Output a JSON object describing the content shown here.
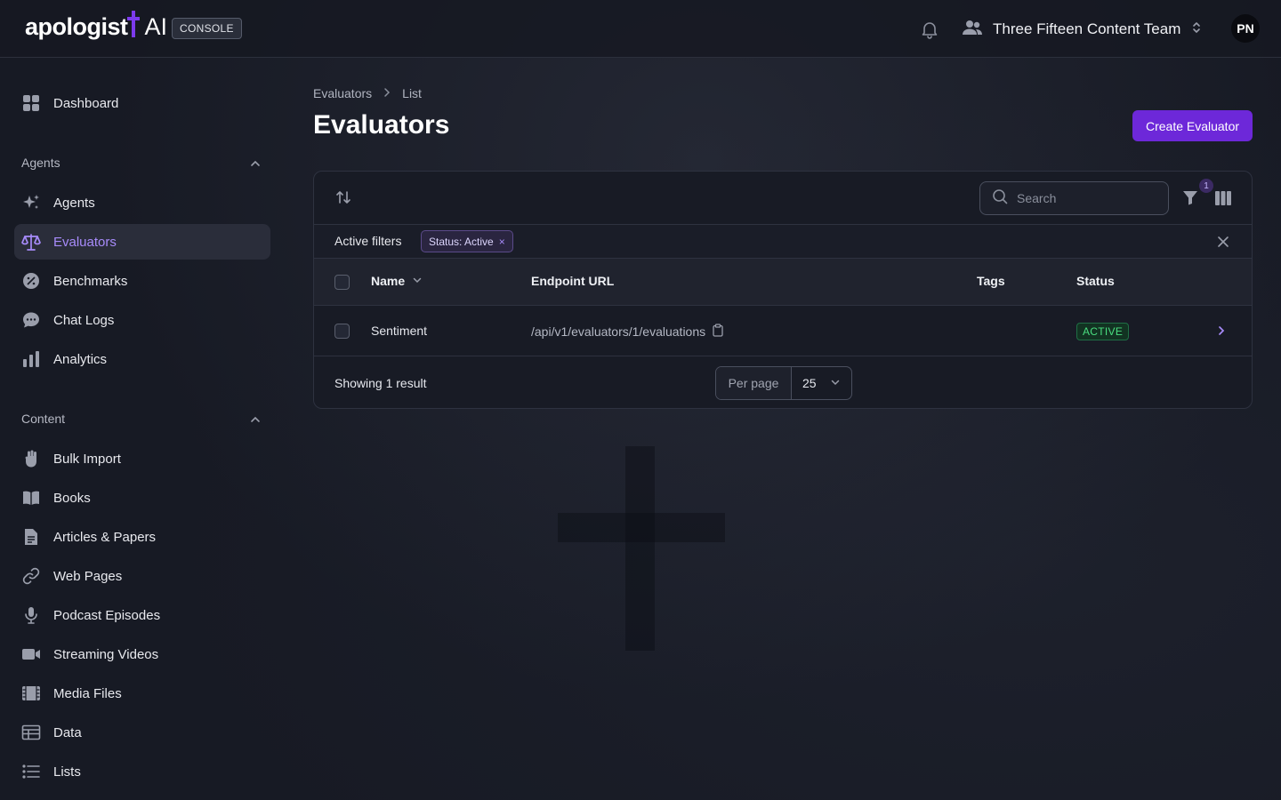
{
  "header": {
    "logo_text": "apologist",
    "logo_ai": "AI",
    "console_badge": "CONSOLE",
    "team_name": "Three Fifteen Content Team",
    "avatar_initials": "PN"
  },
  "sidebar": {
    "dashboard": "Dashboard",
    "groups": {
      "agents": "Agents",
      "content": "Content"
    },
    "agents_items": [
      "Agents",
      "Evaluators",
      "Benchmarks",
      "Chat Logs",
      "Analytics"
    ],
    "content_items": [
      "Bulk Import",
      "Books",
      "Articles & Papers",
      "Web Pages",
      "Podcast Episodes",
      "Streaming Videos",
      "Media Files",
      "Data",
      "Lists"
    ],
    "active_item": "Evaluators"
  },
  "breadcrumb": [
    "Evaluators",
    "List"
  ],
  "page_title": "Evaluators",
  "create_button": "Create Evaluator",
  "toolbar": {
    "search_placeholder": "Search",
    "filter_count": "1"
  },
  "filters": {
    "label": "Active filters",
    "chips": [
      "Status: Active"
    ]
  },
  "table": {
    "columns": [
      "Name",
      "Endpoint URL",
      "Tags",
      "Status"
    ],
    "rows": [
      {
        "name": "Sentiment",
        "endpoint_url": "/api/v1/evaluators/1/evaluations",
        "tags": "",
        "status": "ACTIVE"
      }
    ]
  },
  "pagination": {
    "summary": "Showing 1 result",
    "per_page_label": "Per page",
    "per_page_value": "25"
  },
  "colors": {
    "accent": "#6d28d9",
    "active_nav_text": "#a78bfa",
    "status_active": "#4ade80"
  }
}
